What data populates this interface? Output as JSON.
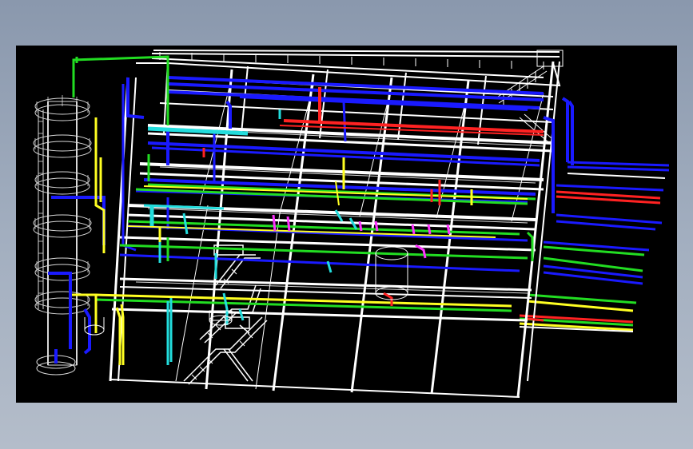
{
  "viewer": {
    "background": "#000000",
    "frame": "#9aa6b8"
  },
  "model": {
    "colors": {
      "structure": "#ffffff",
      "tower": "#d8d8d8",
      "blue_pipe": "#1a1aff",
      "green_pipe": "#22dd22",
      "yellow_pipe": "#ffff22",
      "red_pipe": "#ff2222",
      "cyan_pipe": "#22dddd",
      "magenta_pipe": "#ff33ff"
    }
  }
}
